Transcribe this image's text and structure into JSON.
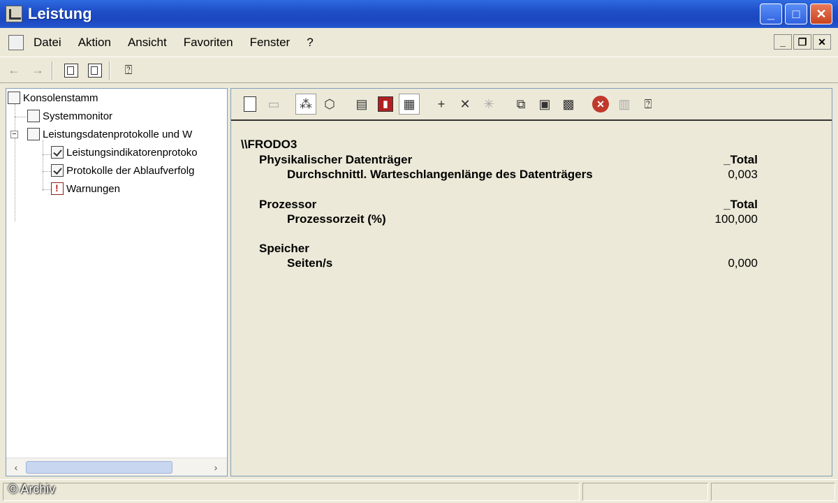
{
  "window": {
    "title": "Leistung"
  },
  "window_buttons": {
    "minimize": "_",
    "maximize": "□",
    "close": "✕"
  },
  "menu": [
    "Datei",
    "Aktion",
    "Ansicht",
    "Favoriten",
    "Fenster",
    "?"
  ],
  "mdi_buttons": {
    "minimize": "_",
    "restore": "❐",
    "close": "✕"
  },
  "tree": {
    "root": "Konsolenstamm",
    "items": [
      {
        "label": "Systemmonitor"
      },
      {
        "label": "Leistungsdatenprotokolle und W"
      },
      {
        "label": "Leistungsindikatorenprotoko"
      },
      {
        "label": "Protokolle der Ablaufverfolg"
      },
      {
        "label": "Warnungen"
      }
    ]
  },
  "report": {
    "machine": "\\\\FRODO3",
    "objects": [
      {
        "name": "Physikalischer Datenträger",
        "instance": "_Total",
        "counter": "Durchschnittl. Warteschlangenlänge des Datenträgers",
        "value": "0,003"
      },
      {
        "name": "Prozessor",
        "instance": "_Total",
        "counter": "Prozessorzeit (%)",
        "value": "100,000"
      },
      {
        "name": "Speicher",
        "instance": "",
        "counter": "Seiten/s",
        "value": "0,000"
      }
    ]
  },
  "watermark": "© Archiv",
  "icons": {
    "back": "back-arrow-icon",
    "forward": "forward-arrow-icon",
    "add": "add-counter-icon",
    "delete": "delete-counter-icon",
    "stop": "freeze-display-icon",
    "help": "help-icon"
  }
}
